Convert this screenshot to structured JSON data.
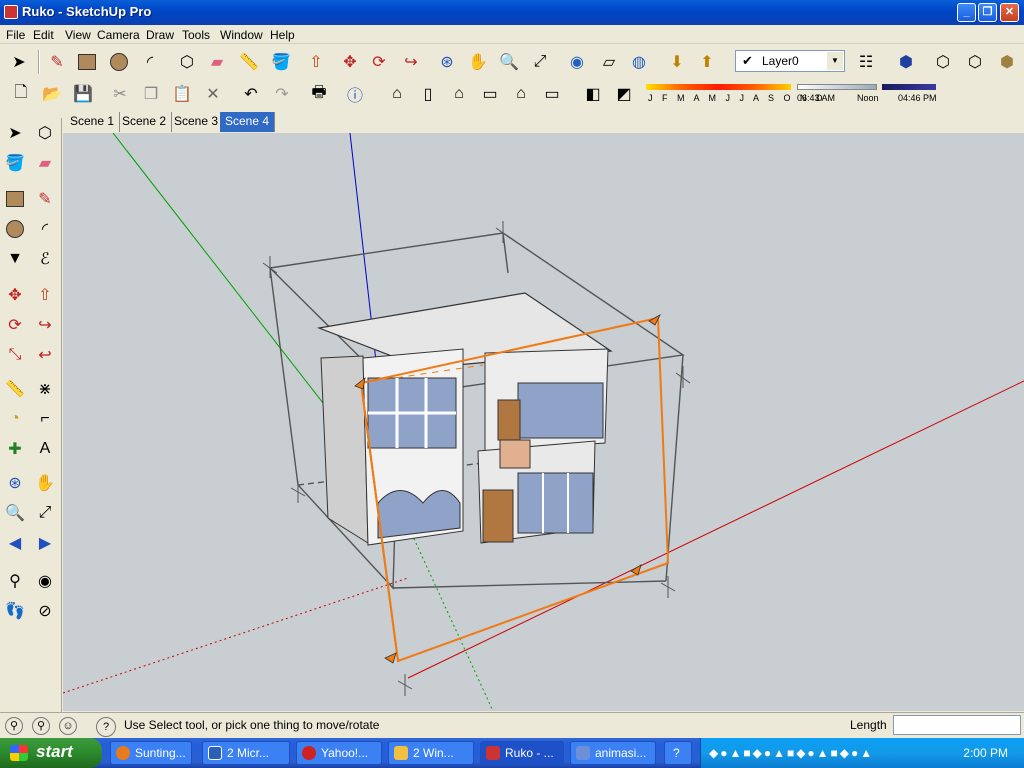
{
  "window": {
    "title": "Ruko - SketchUp Pro"
  },
  "menu": [
    "File",
    "Edit",
    "View",
    "Camera",
    "Draw",
    "Tools",
    "Window",
    "Help"
  ],
  "layer": {
    "selected": "Layer0"
  },
  "shadow": {
    "months": "J F M A M J J A S O N D",
    "sunrise": "06:43 AM",
    "noon": "Noon",
    "sunset": "04:46 PM"
  },
  "scenes": [
    "Scene 1",
    "Scene 2",
    "Scene 3",
    "Scene 4"
  ],
  "active_scene": "Scene 4",
  "status": {
    "message": "Use Select tool, or pick one thing to move/rotate",
    "length_label": "Length",
    "length_value": ""
  },
  "taskbar": {
    "start": "start",
    "tasks": [
      "Sunting...",
      "2 Micr...",
      "Yahoo!...",
      "2 Win...",
      "Ruko - ...",
      "animasi..."
    ],
    "active_task": "Ruko - ...",
    "clock": "2:00 PM"
  },
  "colors": {
    "title_bar": "#0a5fd8",
    "viewport_bg": "#c8ced1",
    "axis_red": "#cc0000",
    "axis_green": "#00a000",
    "axis_blue": "#0000cc",
    "selection_orange": "#f07a14",
    "active_tab": "#316ac5"
  }
}
